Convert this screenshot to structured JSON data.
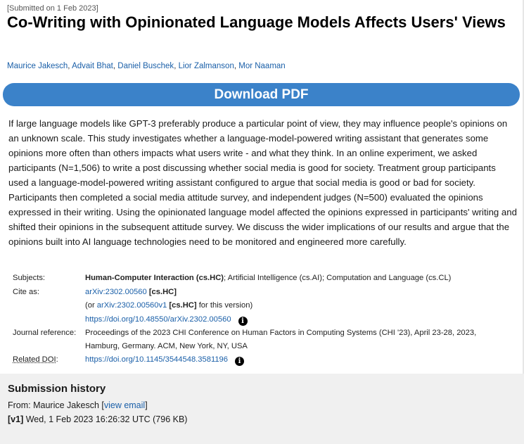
{
  "header": {
    "dateline": "[Submitted on 1 Feb 2023]",
    "title": "Co-Writing with Opinionated Language Models Affects Users' Views",
    "authors": [
      "Maurice Jakesch",
      "Advait Bhat",
      "Daniel Buschek",
      "Lior Zalmanson",
      "Mor Naaman"
    ],
    "author_separator": ", "
  },
  "download": {
    "label": "Download PDF"
  },
  "abstract": "If large language models like GPT-3 preferably produce a particular point of view, they may influence people's opinions on an unknown scale. This study investigates whether a language-model-powered writing assistant that generates some opinions more often than others impacts what users write - and what they think. In an online experiment, we asked participants (N=1,506) to write a post discussing whether social media is good for society. Treatment group participants used a language-model-powered writing assistant configured to argue that social media is good or bad for society. Participants then completed a social media attitude survey, and independent judges (N=500) evaluated the opinions expressed in their writing. Using the opinionated language model affected the opinions expressed in participants' writing and shifted their opinions in the subsequent attitude survey. We discuss the wider implications of our results and argue that the opinions built into AI language technologies need to be monitored and engineered more carefully.",
  "metadata": {
    "subjects_label": "Subjects:",
    "subjects_primary": "Human-Computer Interaction (cs.HC)",
    "subjects_rest": "; Artificial Intelligence (cs.AI); Computation and Language (cs.CL)",
    "cite_label": "Cite as:",
    "cite_id": "arXiv:2302.00560",
    "cite_cat": "[cs.HC]",
    "cite_or": "(or ",
    "cite_version_id": "arXiv:2302.00560v1",
    "cite_version_cat": "[cs.HC]",
    "cite_version_suffix": " for this version)",
    "cite_doi": "https://doi.org/10.48550/arXiv.2302.00560",
    "journal_label": "Journal reference:",
    "journal_value": "Proceedings of the 2023 CHI Conference on Human Factors in Computing Systems (CHI '23), April 23-28, 2023, Hamburg, Germany. ACM, New York, NY, USA",
    "related_doi_label": "Related DOI",
    "related_doi_colon": ":",
    "related_doi": "https://doi.org/10.1145/3544548.3581196",
    "info_glyph": "i"
  },
  "history": {
    "heading": "Submission history",
    "from_prefix": "From: Maurice Jakesch [",
    "view_email": "view email",
    "from_suffix": "]",
    "version_tag": "[v1]",
    "version_date": " Wed, 1 Feb 2023 16:26:32 UTC (796 KB)"
  },
  "icons": {
    "info": "info-circle-icon"
  },
  "colors": {
    "link": "#1a5fa8",
    "download_bg": "#3b82c9",
    "history_bg": "#f0f0f0"
  }
}
